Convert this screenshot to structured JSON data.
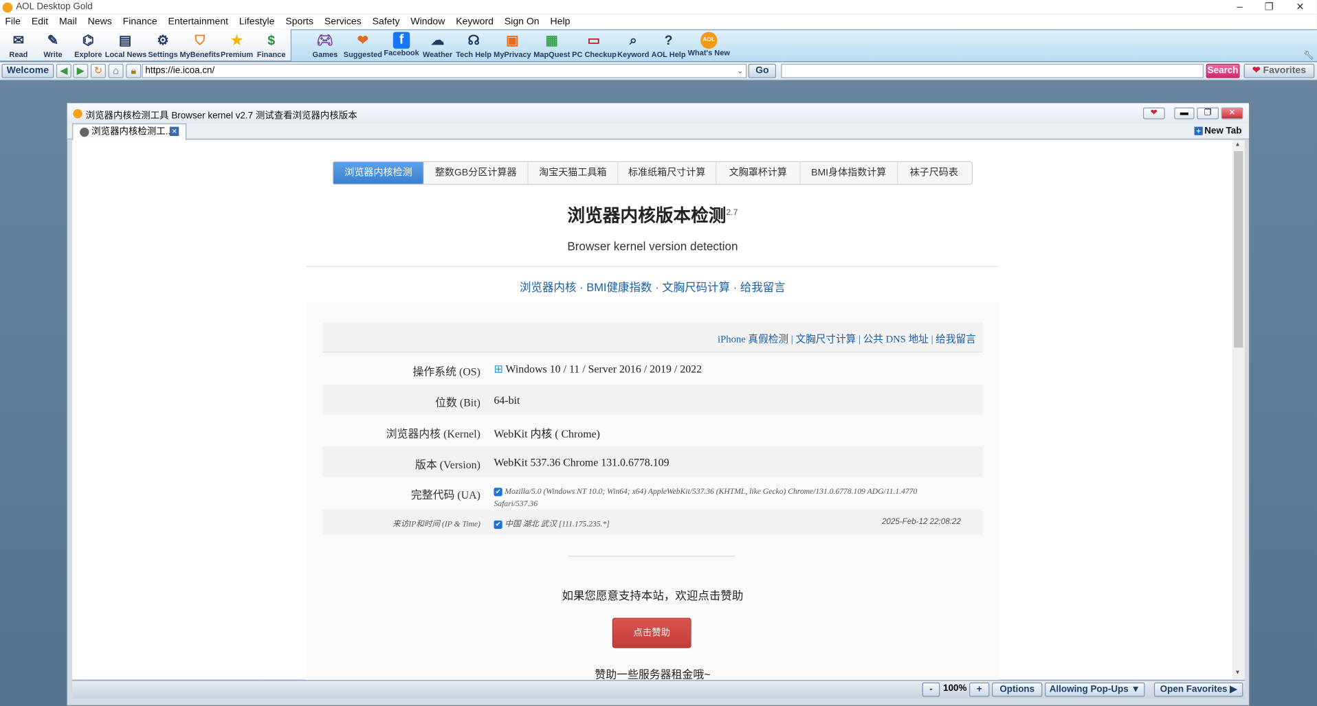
{
  "app": {
    "title": "AOL Desktop Gold"
  },
  "menu": [
    "File",
    "Edit",
    "Mail",
    "News",
    "Finance",
    "Entertainment",
    "Lifestyle",
    "Sports",
    "Services",
    "Safety",
    "Window",
    "Keyword",
    "Sign On",
    "Help"
  ],
  "toolbar": {
    "left": [
      "Read",
      "Write",
      "Explore",
      "Local News",
      "Settings",
      "MyBenefits",
      "Premium",
      "Finance"
    ],
    "right": [
      "Games",
      "Suggested",
      "Facebook",
      "Weather",
      "Tech Help",
      "MyPrivacy",
      "MapQuest",
      "PC Checkup",
      "Keyword",
      "AOL Help",
      "What's New"
    ]
  },
  "address": {
    "welcome": "Welcome",
    "url": "https://ie.icoa.cn/",
    "go": "Go",
    "search": "Search",
    "favorites": "Favorites",
    "search_value": ""
  },
  "window": {
    "title": "浏览器内核检测工具 Browser kernel v2.7 测试查看浏览器内核版本",
    "tab_label": "浏览器内核检测工...",
    "new_tab": "New Tab"
  },
  "page": {
    "nav_tabs": [
      "浏览器内核检测",
      "整数GB分区计算器",
      "淘宝天猫工具箱",
      "标准纸箱尺寸计算",
      "文胸罩杯计算",
      "BMI身体指数计算",
      "袜子尺码表"
    ],
    "heading": "浏览器内核版本检测",
    "version_sup": "2.7",
    "subtitle": "Browser kernel version detection",
    "links": "浏览器内核 · BMI健康指数 · 文胸尺码计算 · 给我留言",
    "top_links": "iPhone 真假检测 | 文胸尺寸计算 | 公共 DNS 地址 | 给我留言",
    "rows": [
      {
        "label": "操作系统 (OS)",
        "value": "Windows 10 / 11 / Server 2016 / 2019 / 2022"
      },
      {
        "label": "位数 (Bit)",
        "value": "64-bit"
      },
      {
        "label": "浏览器内核 (Kernel)",
        "value": "WebKit 内核 ( Chrome)"
      },
      {
        "label": "版本 (Version)",
        "value": "WebKit 537.36  Chrome 131.0.6778.109"
      },
      {
        "label": "完整代码 (UA)",
        "value": "Mozilla/5.0 (Windows NT 10.0; Win64; x64) AppleWebKit/537.36 (KHTML, like Gecko) Chrome/131.0.6778.109 ADG/11.1.4770",
        "value2": "Safari/537.36"
      }
    ],
    "ip_label": "来访IP和时间 (IP & Time)",
    "ip_value": "中国 湖北 武汉 [111.175.235.*]",
    "ip_time": "2025-Feb-12 22:08:22",
    "support_text": "如果您愿意支持本站，欢迎点击赞助",
    "donate_button": "点击赞助",
    "footer_text": "赞助一些服务器租金哦~"
  },
  "status": {
    "minus": "-",
    "zoom": "100%",
    "plus": "+",
    "options": "Options",
    "popups": "Allowing Pop-Ups ▼",
    "open_favorites": "Open Favorites"
  }
}
